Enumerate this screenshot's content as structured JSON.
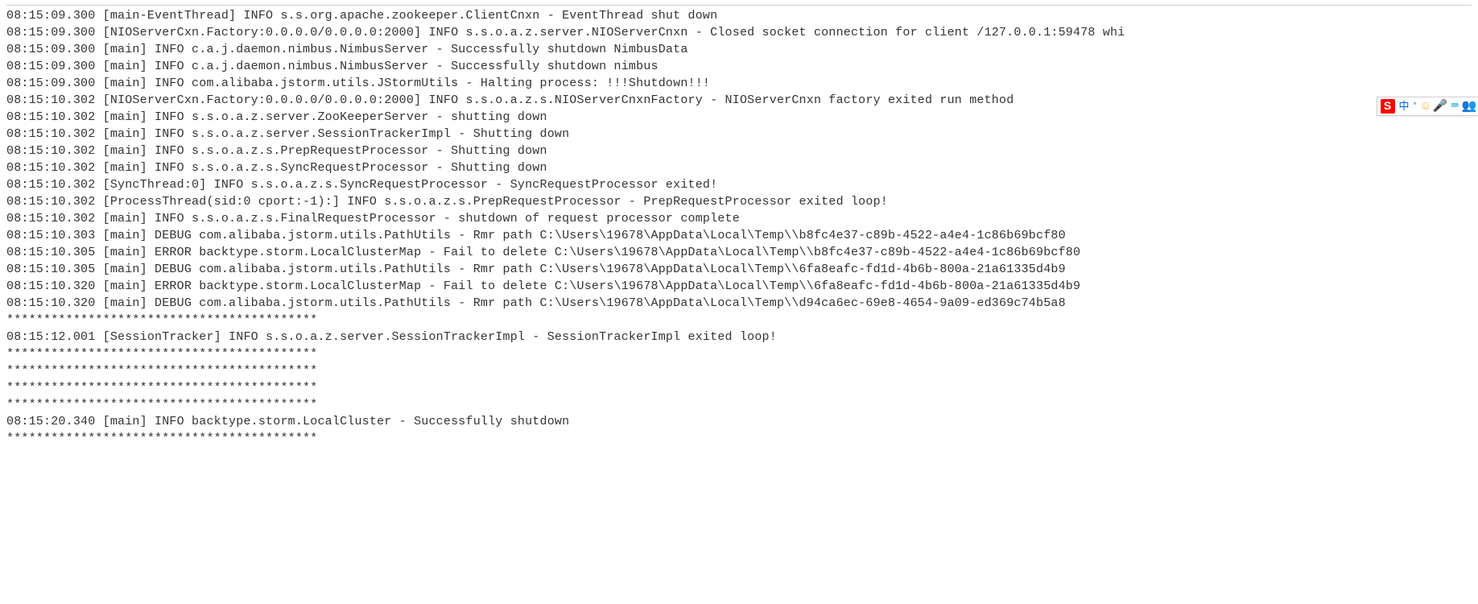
{
  "lines": [
    "08:15:09.300 [main-EventThread] INFO  s.s.org.apache.zookeeper.ClientCnxn - EventThread shut down",
    "08:15:09.300 [NIOServerCxn.Factory:0.0.0.0/0.0.0.0:2000] INFO  s.s.o.a.z.server.NIOServerCnxn - Closed socket connection for client /127.0.0.1:59478 whi",
    "08:15:09.300 [main] INFO  c.a.j.daemon.nimbus.NimbusServer - Successfully shutdown NimbusData",
    "08:15:09.300 [main] INFO  c.a.j.daemon.nimbus.NimbusServer - Successfully shutdown nimbus",
    "08:15:09.300 [main] INFO  com.alibaba.jstorm.utils.JStormUtils - Halting process: !!!Shutdown!!!",
    "08:15:10.302 [NIOServerCxn.Factory:0.0.0.0/0.0.0.0:2000] INFO  s.s.o.a.z.s.NIOServerCnxnFactory - NIOServerCnxn factory exited run method",
    "08:15:10.302 [main] INFO  s.s.o.a.z.server.ZooKeeperServer - shutting down",
    "08:15:10.302 [main] INFO  s.s.o.a.z.server.SessionTrackerImpl - Shutting down",
    "08:15:10.302 [main] INFO  s.s.o.a.z.s.PrepRequestProcessor - Shutting down",
    "08:15:10.302 [main] INFO  s.s.o.a.z.s.SyncRequestProcessor - Shutting down",
    "08:15:10.302 [SyncThread:0] INFO  s.s.o.a.z.s.SyncRequestProcessor - SyncRequestProcessor exited!",
    "08:15:10.302 [ProcessThread(sid:0 cport:-1):] INFO  s.s.o.a.z.s.PrepRequestProcessor - PrepRequestProcessor exited loop!",
    "08:15:10.302 [main] INFO  s.s.o.a.z.s.FinalRequestProcessor - shutdown of request processor complete",
    "08:15:10.303 [main] DEBUG com.alibaba.jstorm.utils.PathUtils - Rmr path C:\\Users\\19678\\AppData\\Local\\Temp\\\\b8fc4e37-c89b-4522-a4e4-1c86b69bcf80",
    "08:15:10.305 [main] ERROR backtype.storm.LocalClusterMap - Fail to delete C:\\Users\\19678\\AppData\\Local\\Temp\\\\b8fc4e37-c89b-4522-a4e4-1c86b69bcf80",
    "08:15:10.305 [main] DEBUG com.alibaba.jstorm.utils.PathUtils - Rmr path C:\\Users\\19678\\AppData\\Local\\Temp\\\\6fa8eafc-fd1d-4b6b-800a-21a61335d4b9",
    "08:15:10.320 [main] ERROR backtype.storm.LocalClusterMap - Fail to delete C:\\Users\\19678\\AppData\\Local\\Temp\\\\6fa8eafc-fd1d-4b6b-800a-21a61335d4b9",
    "08:15:10.320 [main] DEBUG com.alibaba.jstorm.utils.PathUtils - Rmr path C:\\Users\\19678\\AppData\\Local\\Temp\\\\d94ca6ec-69e8-4654-9a09-ed369c74b5a8",
    "******************************************",
    "08:15:12.001 [SessionTracker] INFO  s.s.o.a.z.server.SessionTrackerImpl - SessionTrackerImpl exited loop!",
    "******************************************",
    "******************************************",
    "******************************************",
    "******************************************",
    "08:15:20.340 [main] INFO  backtype.storm.LocalCluster - Successfully shutdown",
    "******************************************"
  ],
  "ime": {
    "logo": "S",
    "lang": "中",
    "punct": "'",
    "smile": "☺",
    "mic": "🎤",
    "kbd": "⌨",
    "user": "👥"
  }
}
